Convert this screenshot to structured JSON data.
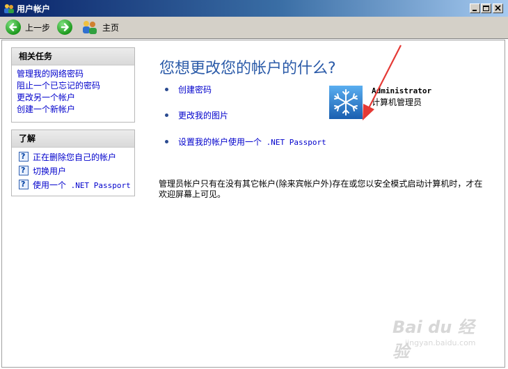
{
  "window": {
    "title": "用户帐户",
    "controls": [
      "minimize-icon",
      "maximize-icon",
      "close-icon"
    ]
  },
  "toolbar": {
    "back_label": "上一步",
    "home_label": "主页",
    "icons": [
      "back-arrow-icon",
      "forward-arrow-icon",
      "users-home-icon"
    ]
  },
  "related_tasks": {
    "title": "相关任务",
    "items": [
      {
        "label": "管理我的网络密码"
      },
      {
        "label": "阻止一个已忘记的密码"
      },
      {
        "label": "更改另一个帐户"
      },
      {
        "label": "创建一个新帐户"
      }
    ]
  },
  "learn_about": {
    "title": "了解",
    "items": [
      {
        "label": "正在删除您自己的帐户",
        "icon": "help-icon"
      },
      {
        "label": "切换用户",
        "icon": "help-icon"
      },
      {
        "label": "使用一个 .NET Passport",
        "icon": "help-icon"
      }
    ]
  },
  "main": {
    "heading": "您想更改您的帐户的什么?",
    "options": [
      {
        "label": "创建密码"
      },
      {
        "label": "更改我的图片"
      },
      {
        "label": "设置我的帐户使用一个 .NET Passport"
      }
    ],
    "account": {
      "name": "Administrator",
      "type": "计算机管理员",
      "picture_icon": "snowflake-icon"
    },
    "note": "管理员帐户只有在没有其它帐户(除来宾帐户外)存在或您以安全模式启动计算机时，才在欢迎屏幕上可见。"
  },
  "watermark": {
    "brand": "Bai du 经验",
    "url": "jingyan.baidu.com"
  },
  "colors": {
    "title_bar_start": "#0a246a",
    "title_bar_end": "#a6caf0",
    "link": "#0000cc",
    "heading": "#2a5aa8",
    "annotation_arrow": "#e53935"
  }
}
